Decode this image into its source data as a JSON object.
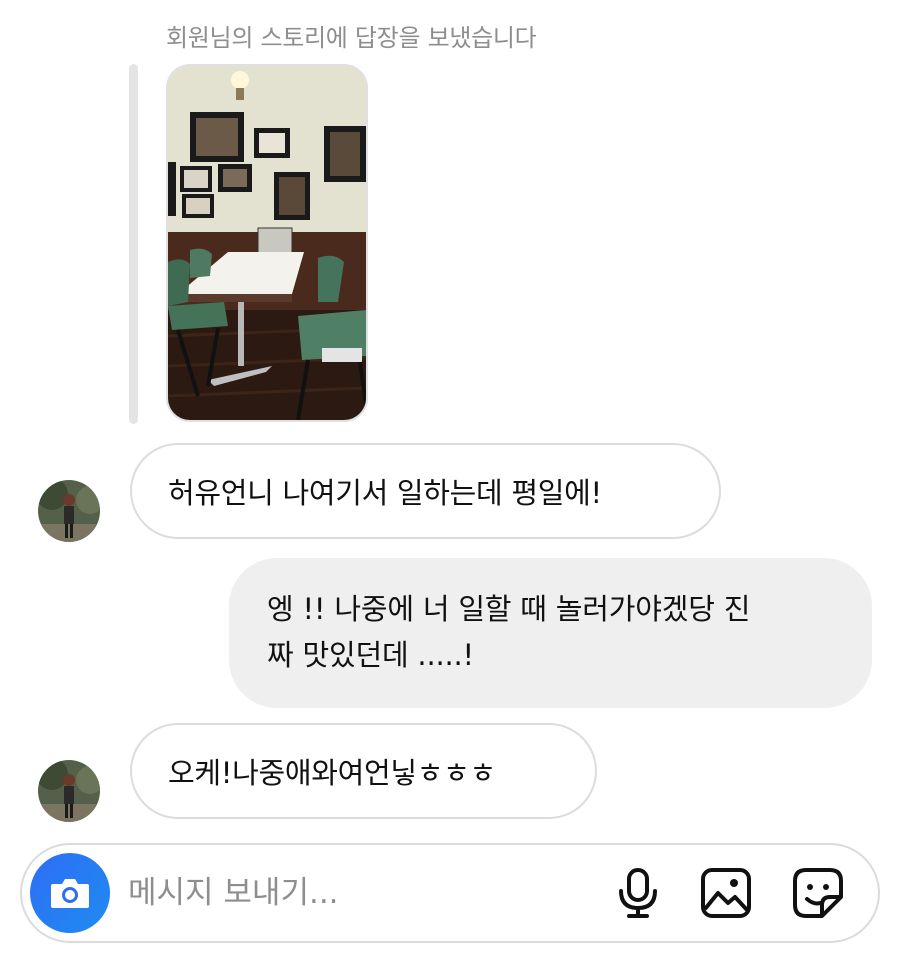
{
  "story_reply": {
    "caption": "회원님의 스토리에 답장을 보냈습니다",
    "thumbnail_icon": "cafe-interior-photo"
  },
  "messages": [
    {
      "direction": "incoming",
      "text": "허유언니 나여기서 일하는데 평일에!"
    },
    {
      "direction": "outgoing",
      "line1": "엥 !! 나중에 너 일할 때 놀러가야겠당 진",
      "line2": "짜 맛있던데 .....!"
    },
    {
      "direction": "incoming",
      "text": "오케!나중애와여언닣ㅎㅎㅎ"
    }
  ],
  "composer": {
    "placeholder": "메시지 보내기...",
    "value": "",
    "camera_icon": "camera-icon",
    "mic_icon": "microphone-icon",
    "gallery_icon": "image-icon",
    "sticker_icon": "sticker-icon"
  },
  "colors": {
    "accent": "#2f6df5",
    "incoming_border": "#dcdcdc",
    "outgoing_bg": "#efefef",
    "caption": "#8e8e8e"
  }
}
